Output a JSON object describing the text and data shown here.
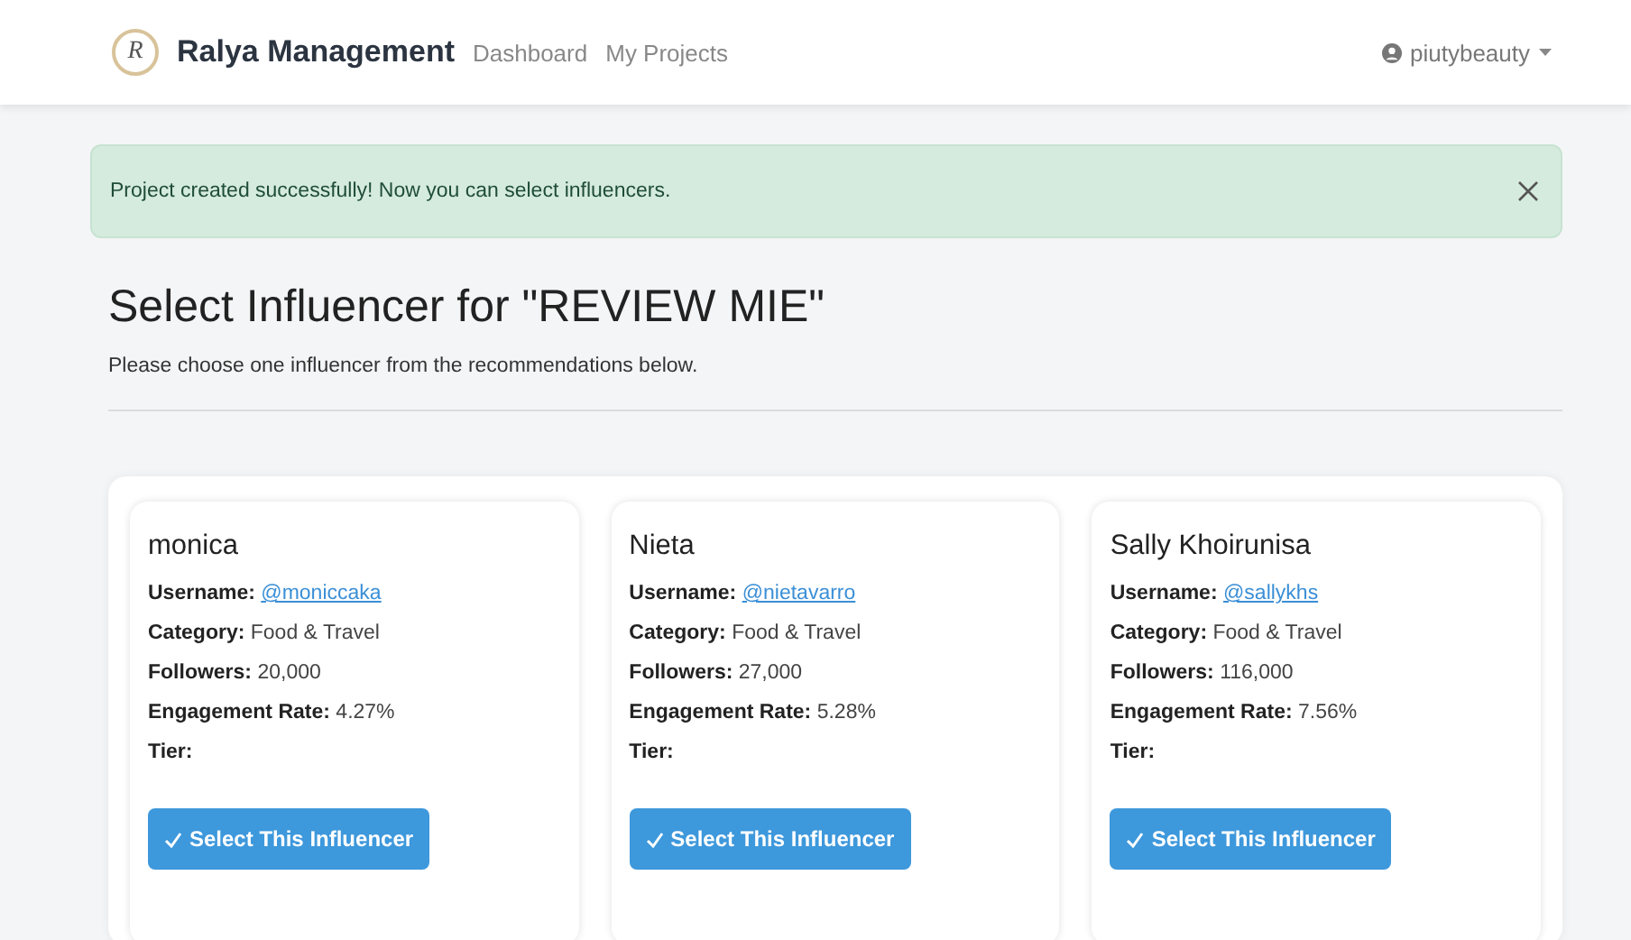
{
  "navbar": {
    "logo_text": "R",
    "brand": "Ralya Management",
    "links": [
      {
        "label": "Dashboard",
        "selected": false
      },
      {
        "label": "My Projects",
        "selected": false
      }
    ],
    "user": "piutybeauty"
  },
  "alert": {
    "message": "Project created successfully! Now you can select influencers."
  },
  "title": "Select Influencer for \"REVIEW MIE\"",
  "subtitle": "Please choose one influencer from the recommendations below.",
  "influencers": [
    {
      "name": "monica",
      "fields": [
        {
          "label": "Username:",
          "value": "@moniccaka",
          "kind": "link"
        },
        {
          "label": "Category:",
          "value": "Food & Travel",
          "kind": "text"
        },
        {
          "label": "Followers:",
          "value": "20,000",
          "kind": "text"
        },
        {
          "label": "Engagement Rate:",
          "value": "4.27%",
          "kind": "text"
        },
        {
          "label": "Tier:",
          "kind": "text"
        }
      ],
      "button": "Select This Influencer"
    },
    {
      "name": "Nieta",
      "fields": [
        {
          "label": "Username:",
          "value": "@nietavarro",
          "kind": "link"
        },
        {
          "label": "Category:",
          "value": "Food & Travel",
          "kind": "text"
        },
        {
          "label": "Followers:",
          "value": "27,000",
          "kind": "text"
        },
        {
          "label": "Engagement Rate:",
          "value": "5.28%",
          "kind": "text"
        },
        {
          "label": "Tier:",
          "kind": "text"
        }
      ],
      "button": "Select This Influencer"
    },
    {
      "name": "Sally Khoirunisa",
      "fields": [
        {
          "label": "Username:",
          "value": "@sallykhs",
          "kind": "link"
        },
        {
          "label": "Category:",
          "value": "Food & Travel",
          "kind": "text"
        },
        {
          "label": "Followers:",
          "value": "116,000",
          "kind": "text"
        },
        {
          "label": "Engagement Rate:",
          "value": "7.56%",
          "kind": "text"
        },
        {
          "label": "Tier:",
          "kind": "text"
        }
      ],
      "button": "Select This Influencer"
    }
  ]
}
